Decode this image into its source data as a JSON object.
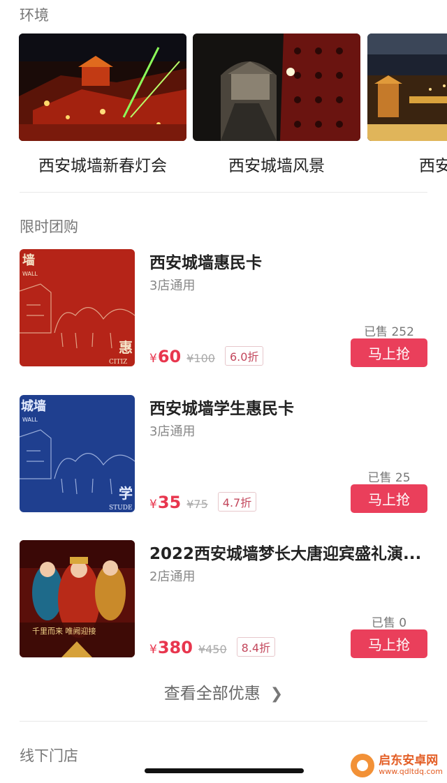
{
  "environment": {
    "title": "环境",
    "items": [
      {
        "label": "西安城墙新春灯会"
      },
      {
        "label": "西安城墙风景"
      },
      {
        "label": "西安城墙"
      }
    ]
  },
  "deals": {
    "title": "限时团购",
    "items": [
      {
        "name": "西安城墙惠民卡",
        "stores": "3店通用",
        "price_symbol": "¥",
        "price": "60",
        "original": "¥100",
        "discount": "6.0折",
        "sold": "已售 252",
        "buy_label": "马上抢",
        "thumb_text_top": "墙",
        "thumb_text_small": "WALL",
        "thumb_text_bottom": "惠",
        "thumb_text_en": "CITIZ"
      },
      {
        "name": "西安城墙学生惠民卡",
        "stores": "3店通用",
        "price_symbol": "¥",
        "price": "35",
        "original": "¥75",
        "discount": "4.7折",
        "sold": "已售 25",
        "buy_label": "马上抢",
        "thumb_text_top": "城墙",
        "thumb_text_small": "WALL",
        "thumb_text_bottom": "学",
        "thumb_text_en": "STUDE"
      },
      {
        "name": "2022西安城墙梦长大唐迎宾盛礼演...",
        "stores": "2店通用",
        "price_symbol": "¥",
        "price": "380",
        "original": "¥450",
        "discount": "8.4折",
        "sold": "已售 0",
        "buy_label": "马上抢",
        "thumb_text": "千里而来 唯阙迎接"
      }
    ]
  },
  "view_all": {
    "label": "查看全部优惠",
    "icon": "chevron-right-icon"
  },
  "stores": {
    "title": "线下门店"
  },
  "watermark": {
    "name": "启东安卓网",
    "url": "www.qdltdq.com"
  },
  "colors": {
    "accent": "#ea3f5b",
    "price": "#e8364e",
    "muted": "#777777"
  }
}
